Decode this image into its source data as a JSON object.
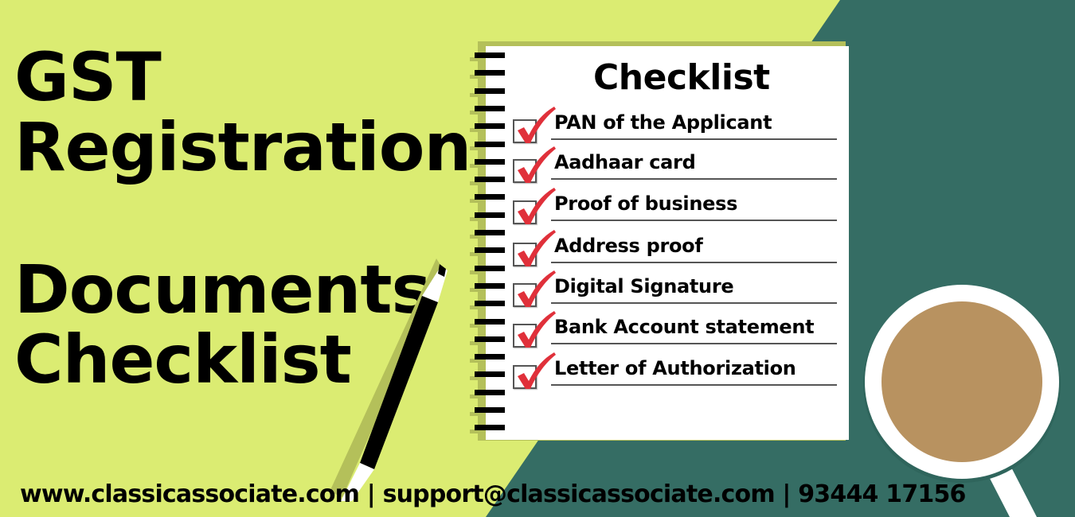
{
  "colors": {
    "lime_background": "#dbec72",
    "teal_background": "#356d64",
    "check_red": "#e0303a",
    "coffee": "#b89260",
    "text": "#000000"
  },
  "headline": {
    "line1": "GST",
    "line2": "Registration",
    "line3": "Documents",
    "line4": "Checklist"
  },
  "notepad": {
    "title": "Checklist",
    "items": [
      {
        "label": "PAN of the Applicant",
        "checked": true
      },
      {
        "label": "Aadhaar card",
        "checked": true
      },
      {
        "label": "Proof of business",
        "checked": true
      },
      {
        "label": "Address proof",
        "checked": true
      },
      {
        "label": "Digital Signature",
        "checked": true
      },
      {
        "label": "Bank Account statement",
        "checked": true
      },
      {
        "label": "Letter of Authorization",
        "checked": true
      }
    ]
  },
  "icons": {
    "pen": "pen-icon",
    "checkmark": "checkmark-icon",
    "coffee_cup": "coffee-cup-icon"
  },
  "footer": {
    "contact": "www.classicassociate.com | support@classicassociate.com | 93444 17156"
  }
}
